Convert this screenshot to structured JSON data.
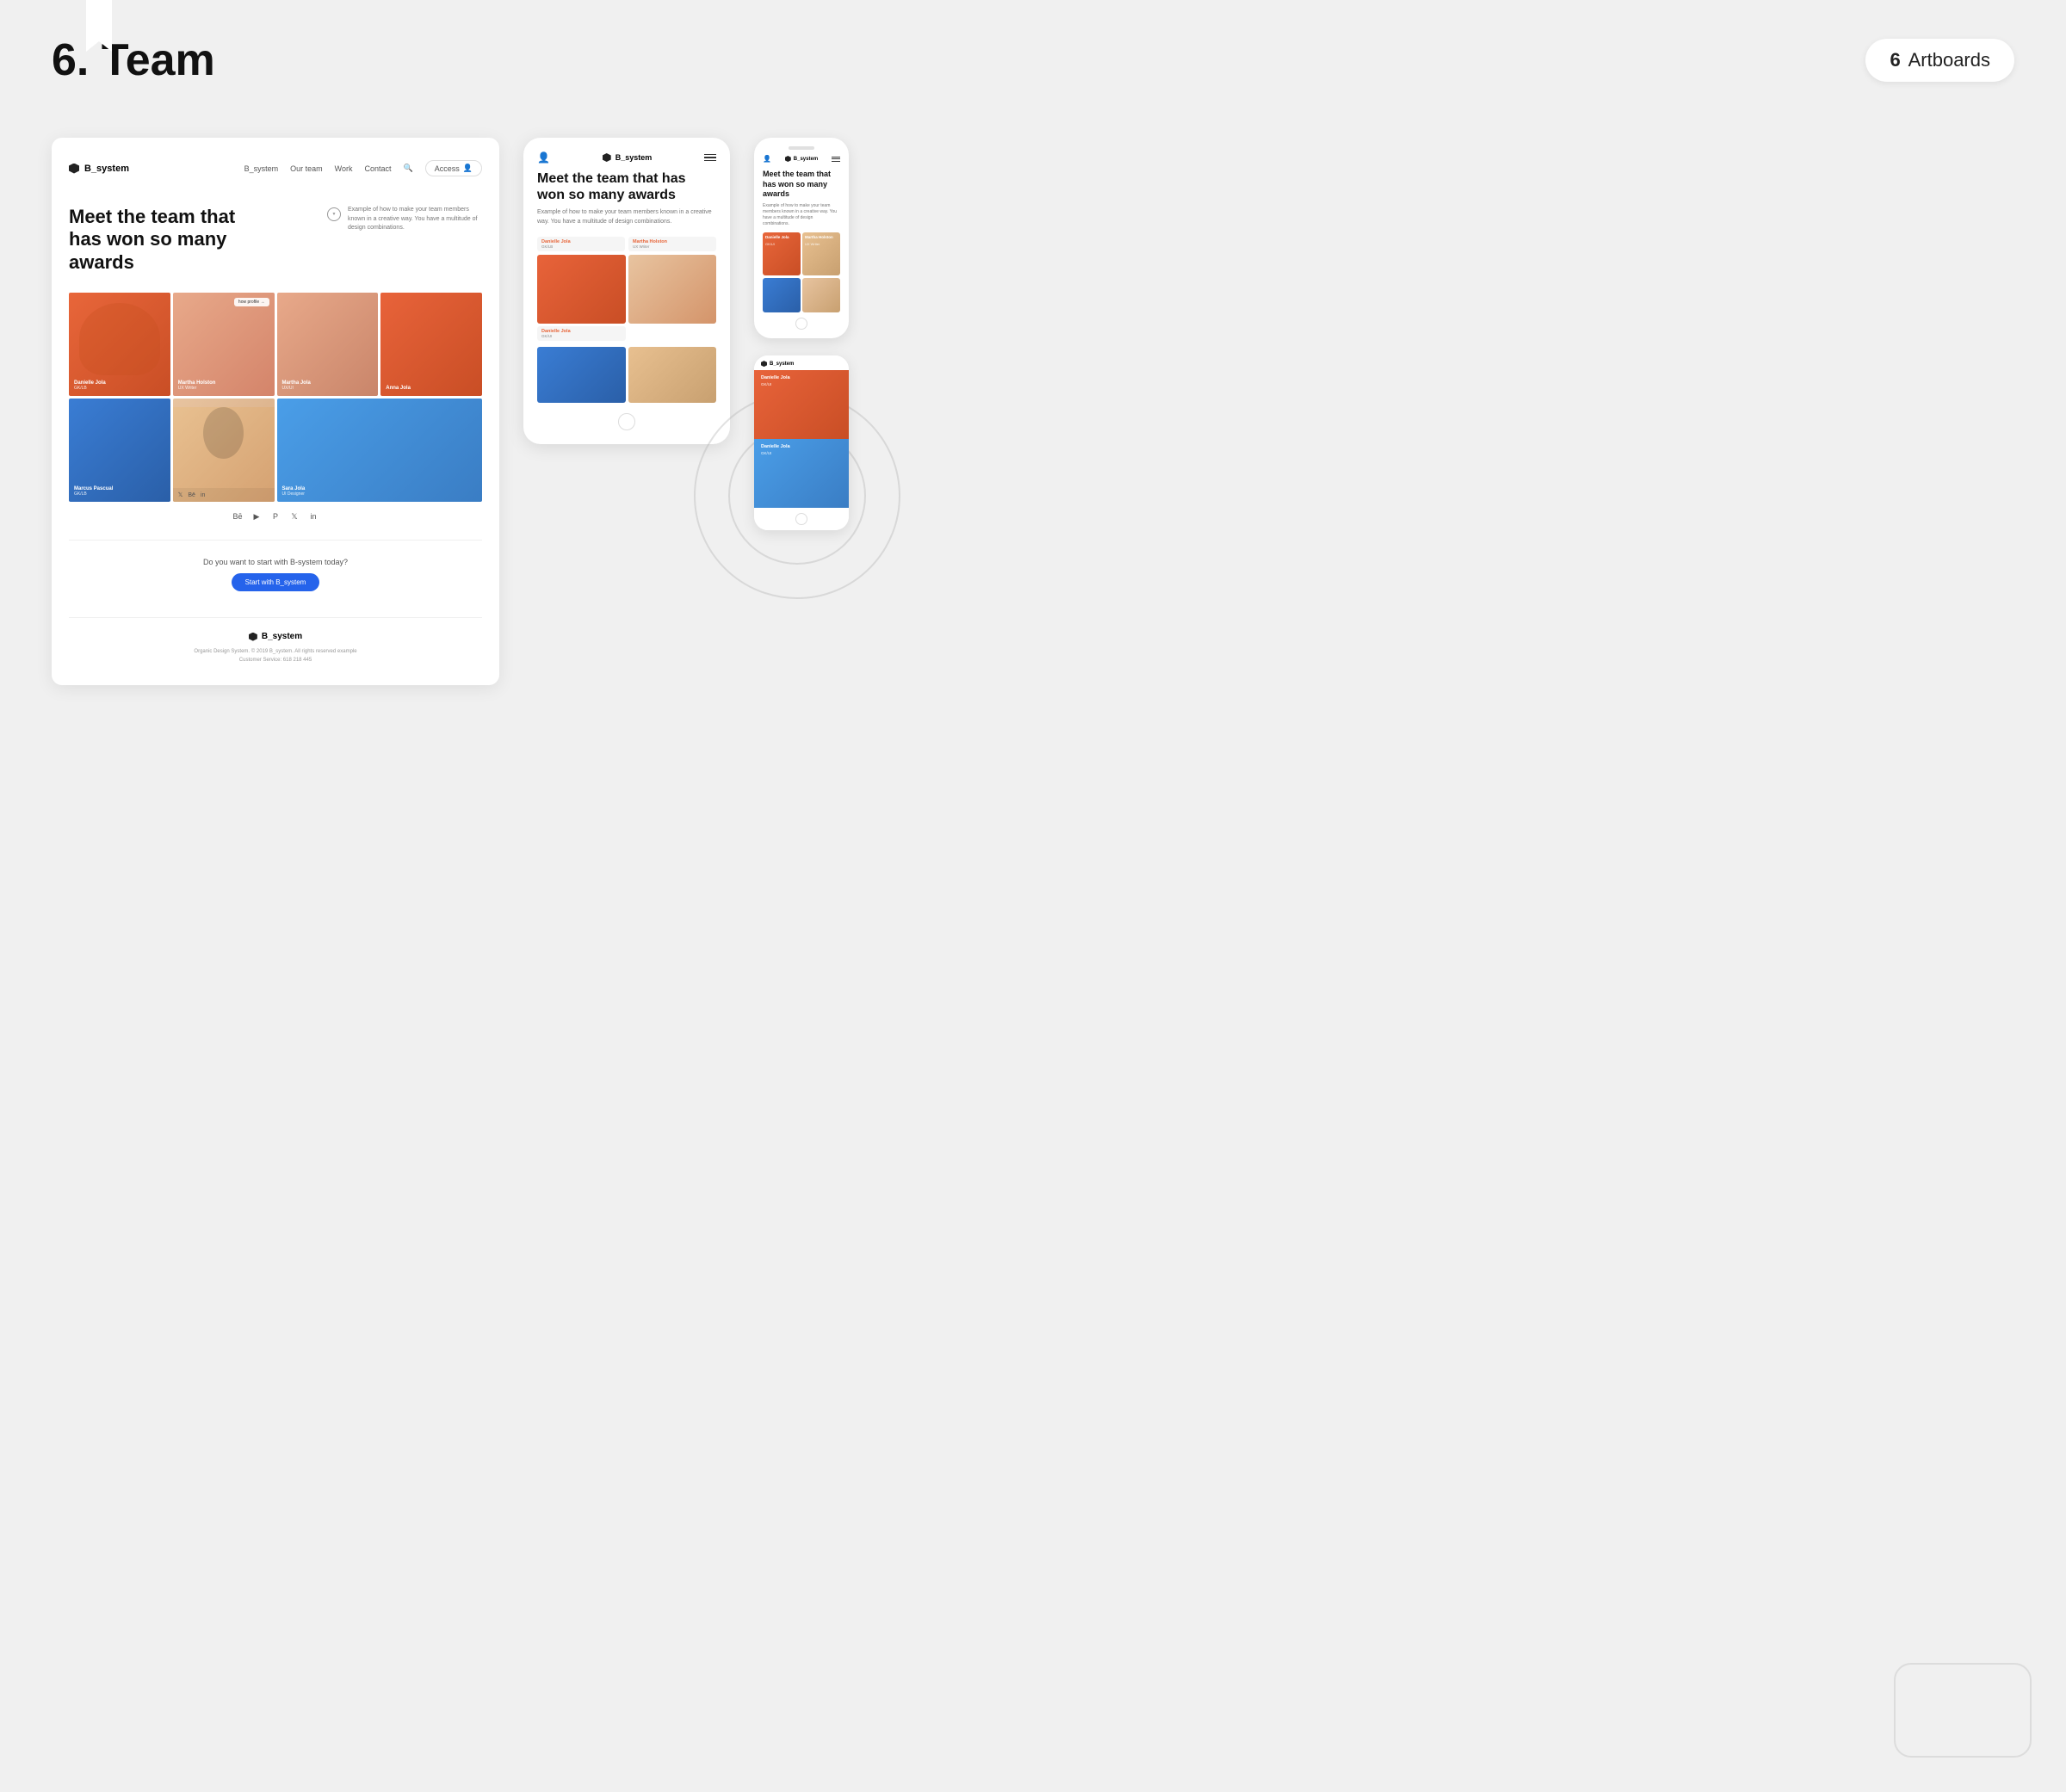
{
  "page": {
    "title": "6. Team",
    "artboards_label": "Artboards",
    "artboards_count": "6"
  },
  "bookmark": {
    "visible": true
  },
  "desktop": {
    "nav": {
      "logo": "B_system",
      "links": [
        "B_system",
        "Our team",
        "Work",
        "Contact"
      ],
      "access_label": "Access"
    },
    "hero": {
      "heading": "Meet the team that has won so many awards",
      "desc_icon": "location-icon",
      "description": "Example of how to make your team members known in a creative way. You have a multitude of design combinations."
    },
    "team_members": [
      {
        "name": "Danielle Jola",
        "role": "GK/LB"
      },
      {
        "name": "Martha Holston",
        "role": "UX Writer"
      },
      {
        "name": "how profile →",
        "role": ""
      },
      {
        "name": "Martha Jola",
        "role": "UX/UI"
      },
      {
        "name": "Anna Jola",
        "role": ""
      },
      {
        "name": "Marcus Pascual",
        "role": "GK/LB"
      },
      {
        "name": "",
        "role": ""
      },
      {
        "name": "Sara Jola",
        "role": "UI Designer"
      }
    ],
    "social_icons": [
      "be",
      "youtube",
      "pinterest",
      "twitter",
      "linkedin"
    ],
    "cta": {
      "question": "Do you want to start with B-system today?",
      "button_label": "Start with B_system"
    },
    "footer": {
      "logo": "B_system",
      "copyright": "Organic Design System. © 2019 B_system. All rights reserved example",
      "service": "Customer Service: 618 218 445"
    }
  },
  "tablet": {
    "logo": "B_system",
    "hero_heading": "Meet the team that has won so many awards",
    "hero_desc": "Example of how to make your team members known in a creative way. You have a multitude of design combinations.",
    "members": [
      {
        "name": "Danielle Jola",
        "role": "GK/LB"
      },
      {
        "name": "Martha Holston",
        "role": "UX Writer"
      },
      {
        "name": "Danielle Jola",
        "role": "GK/UI"
      }
    ]
  },
  "phone1": {
    "logo": "B_system",
    "hero_heading": "Meet the team that has won so many awards",
    "hero_desc": "Example of how to make your team members known in a creative way. You have a multitude of design combinations.",
    "members": [
      {
        "name": "Danielle Jola",
        "role": "GK/UI"
      },
      {
        "name": "Martha Holston",
        "role": "UX Writer"
      }
    ]
  },
  "phone2": {
    "card1_name": "Danielle Jola",
    "card1_role": "GK/UI",
    "card2_name": "Danielle Jola",
    "card2_role": "GK/UI"
  },
  "colors": {
    "orange": "#e8633a",
    "blue": "#2563eb",
    "peach": "#e8c4a0",
    "sky": "#4a9ee8",
    "dark": "#111111"
  }
}
